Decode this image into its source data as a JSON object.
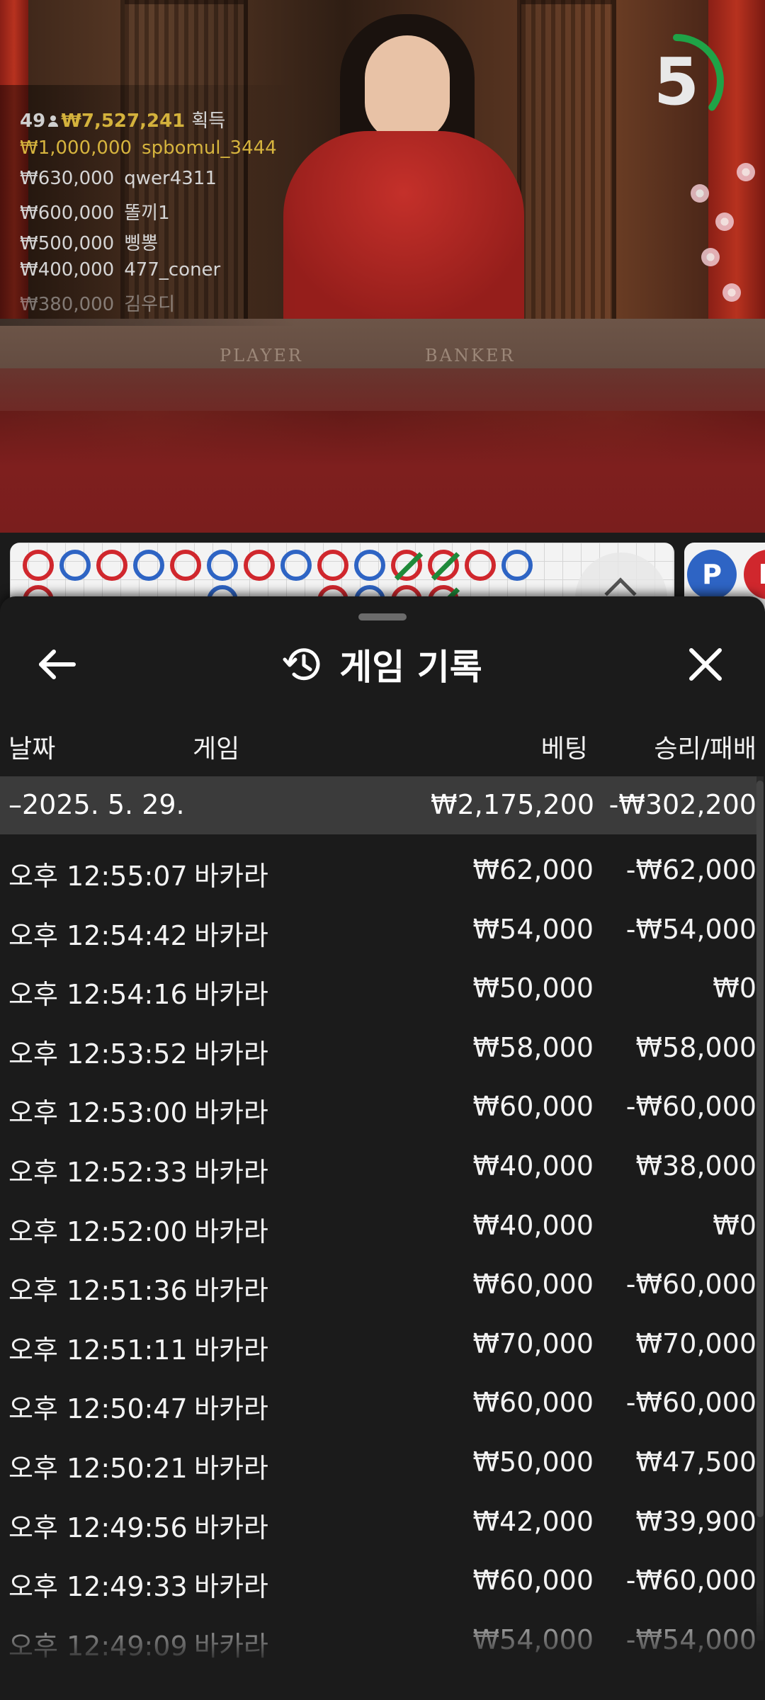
{
  "video": {
    "felt_labels": {
      "player": "PLAYER",
      "banker": "BANKER"
    },
    "winners": {
      "count": "49",
      "total": "₩7,527,241",
      "total_label": "획득",
      "entries": [
        {
          "amount": "₩1,000,000",
          "user": "spbomul_3444"
        },
        {
          "amount": "₩630,000",
          "user": "qwer4311"
        },
        {
          "amount": "₩600,000",
          "user": "똘끼1"
        },
        {
          "amount": "₩500,000",
          "user": "삥뽕"
        },
        {
          "amount": "₩400,000",
          "user": "477_coner"
        },
        {
          "amount": "₩380,000",
          "user": "김우디"
        }
      ]
    },
    "timer": {
      "seconds": "5",
      "remaining_fraction": 0.35
    },
    "side_badges": [
      "P",
      "B"
    ],
    "colors": {
      "player": "#2e64c4",
      "banker": "#d0272d",
      "tie": "#1f8a3a",
      "timer": "#1fa347",
      "winner_gold": "#d6b43e"
    }
  },
  "roadmap": {
    "beads_row1": [
      "banker",
      "player",
      "banker",
      "player",
      "banker",
      "player",
      "banker",
      "player",
      "banker",
      "player",
      "tie",
      "tie",
      "banker",
      "player"
    ],
    "beads_row2": [
      "banker",
      "",
      "",
      "",
      "",
      "player",
      "",
      "",
      "banker",
      "player",
      "banker",
      "tie",
      "",
      ""
    ]
  },
  "sheet": {
    "title": "게임 기록",
    "columns": {
      "date": "날짜",
      "game": "게임",
      "bet": "베팅",
      "result": "승리/패배"
    },
    "date_group": {
      "date": "–2025. 5. 29.",
      "bet": "₩2,175,200",
      "result": "-₩302,200"
    },
    "rows": [
      {
        "time": "오후 12:55:07",
        "game": "바카라",
        "bet": "₩62,000",
        "result": "-₩62,000"
      },
      {
        "time": "오후 12:54:42",
        "game": "바카라",
        "bet": "₩54,000",
        "result": "-₩54,000"
      },
      {
        "time": "오후 12:54:16",
        "game": "바카라",
        "bet": "₩50,000",
        "result": "₩0"
      },
      {
        "time": "오후 12:53:52",
        "game": "바카라",
        "bet": "₩58,000",
        "result": "₩58,000"
      },
      {
        "time": "오후 12:53:00",
        "game": "바카라",
        "bet": "₩60,000",
        "result": "-₩60,000"
      },
      {
        "time": "오후 12:52:33",
        "game": "바카라",
        "bet": "₩40,000",
        "result": "₩38,000"
      },
      {
        "time": "오후 12:52:00",
        "game": "바카라",
        "bet": "₩40,000",
        "result": "₩0"
      },
      {
        "time": "오후 12:51:36",
        "game": "바카라",
        "bet": "₩60,000",
        "result": "-₩60,000"
      },
      {
        "time": "오후 12:51:11",
        "game": "바카라",
        "bet": "₩70,000",
        "result": "₩70,000"
      },
      {
        "time": "오후 12:50:47",
        "game": "바카라",
        "bet": "₩60,000",
        "result": "-₩60,000"
      },
      {
        "time": "오후 12:50:21",
        "game": "바카라",
        "bet": "₩50,000",
        "result": "₩47,500"
      },
      {
        "time": "오후 12:49:56",
        "game": "바카라",
        "bet": "₩42,000",
        "result": "₩39,900"
      },
      {
        "time": "오후 12:49:33",
        "game": "바카라",
        "bet": "₩60,000",
        "result": "-₩60,000"
      },
      {
        "time": "오후 12:49:09",
        "game": "바카라",
        "bet": "₩54,000",
        "result": "-₩54,000"
      }
    ],
    "icons": {
      "back": "arrow-left-icon",
      "history": "history-icon",
      "close": "close-icon"
    }
  }
}
